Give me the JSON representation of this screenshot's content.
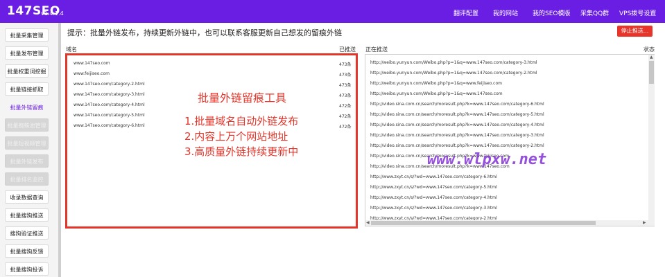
{
  "app": {
    "brand": "147SEO",
    "version": "v1.4.1.4"
  },
  "nav": [
    "翻评配置",
    "我的网站",
    "我的SEO模版",
    "采集QQ群",
    "VPS拨号设置"
  ],
  "sidebar": [
    {
      "label": "批量采集管理",
      "state": "normal"
    },
    {
      "label": "批量发布管理",
      "state": "normal"
    },
    {
      "label": "批量权重词挖掘",
      "state": "normal"
    },
    {
      "label": "批量链接抓取",
      "state": "normal"
    },
    {
      "label": "批量外链留痕",
      "state": "active"
    },
    {
      "label": "批量蜘蛛池管理",
      "state": "disabled"
    },
    {
      "label": "批量短视频管理",
      "state": "disabled"
    },
    {
      "label": "批量外链发布",
      "state": "disabled"
    },
    {
      "label": "批量排名监控",
      "state": "disabled"
    },
    {
      "label": "收录数据查询",
      "state": "normal"
    },
    {
      "label": "批量搜狗推送",
      "state": "normal"
    },
    {
      "label": "搜狗验证推送",
      "state": "normal"
    },
    {
      "label": "批量搜狗反馈",
      "state": "normal"
    },
    {
      "label": "批量搜狗投诉",
      "state": "normal"
    }
  ],
  "tip": "提示：批量外链发布，持续更新外链中，也可以联系客服更新自己想发的留痕外链",
  "stop_button": "停止推送...",
  "columns": {
    "domain": "域名",
    "pushed": "已推送",
    "pushing": "正在推送",
    "status": "状态"
  },
  "domains": [
    {
      "domain": "www.147seo.com",
      "count": "473条"
    },
    {
      "domain": "www.feijiseo.com",
      "count": "473条"
    },
    {
      "domain": "www.147seo.com/category-2.html",
      "count": "473条"
    },
    {
      "domain": "www.147seo.com/category-3.html",
      "count": "473条"
    },
    {
      "domain": "www.147seo.com/category-4.html",
      "count": "472条"
    },
    {
      "domain": "www.147seo.com/category-5.html",
      "count": "472条"
    },
    {
      "domain": "www.147seo.com/category-6.html",
      "count": "472条"
    }
  ],
  "annotation": {
    "title": "批量外链留痕工具",
    "lines": [
      "1.批量域名自动外链发布",
      "2.内容上万个网站地址",
      "3.高质量外链持续更新中"
    ]
  },
  "pushing_urls": [
    "http://weibo.yunyun.com/Weibo.php?p=1&q=www.147seo.com/category-3.html",
    "http://weibo.yunyun.com/Weibo.php?p=1&q=www.147seo.com/category-2.html",
    "http://weibo.yunyun.com/Weibo.php?p=1&q=www.feijiseo.com",
    "http://weibo.yunyun.com/Weibo.php?p=1&q=www.147seo.com",
    "http://video.sina.com.cn/search/moresult.php?k=www.147seo.com/category-6.html",
    "http://video.sina.com.cn/search/moresult.php?k=www.147seo.com/category-5.html",
    "http://video.sina.com.cn/search/moresult.php?k=www.147seo.com/category-4.html",
    "http://video.sina.com.cn/search/moresult.php?k=www.147seo.com/category-3.html",
    "http://video.sina.com.cn/search/moresult.php?k=www.147seo.com/category-2.html",
    "http://video.sina.com.cn/search/moresult.php?k=www.feijiseo.com",
    "http://video.sina.com.cn/search/moresult.php?k=www.147seo.com",
    "http://www.zxyt.cn/s/?wd=www.147seo.com/category-6.html",
    "http://www.zxyt.cn/s/?wd=www.147seo.com/category-5.html",
    "http://www.zxyt.cn/s/?wd=www.147seo.com/category-4.html",
    "http://www.zxyt.cn/s/?wd=www.147seo.com/category-3.html",
    "http://www.zxyt.cn/s/?wd=www.147seo.com/category-2.html"
  ],
  "watermark": "www.wlpxw.net",
  "colors": {
    "brand": "#6a1de3",
    "accent_red": "#e3362b",
    "stop_button": "#e8352a",
    "watermark": "#8a3fd8"
  }
}
